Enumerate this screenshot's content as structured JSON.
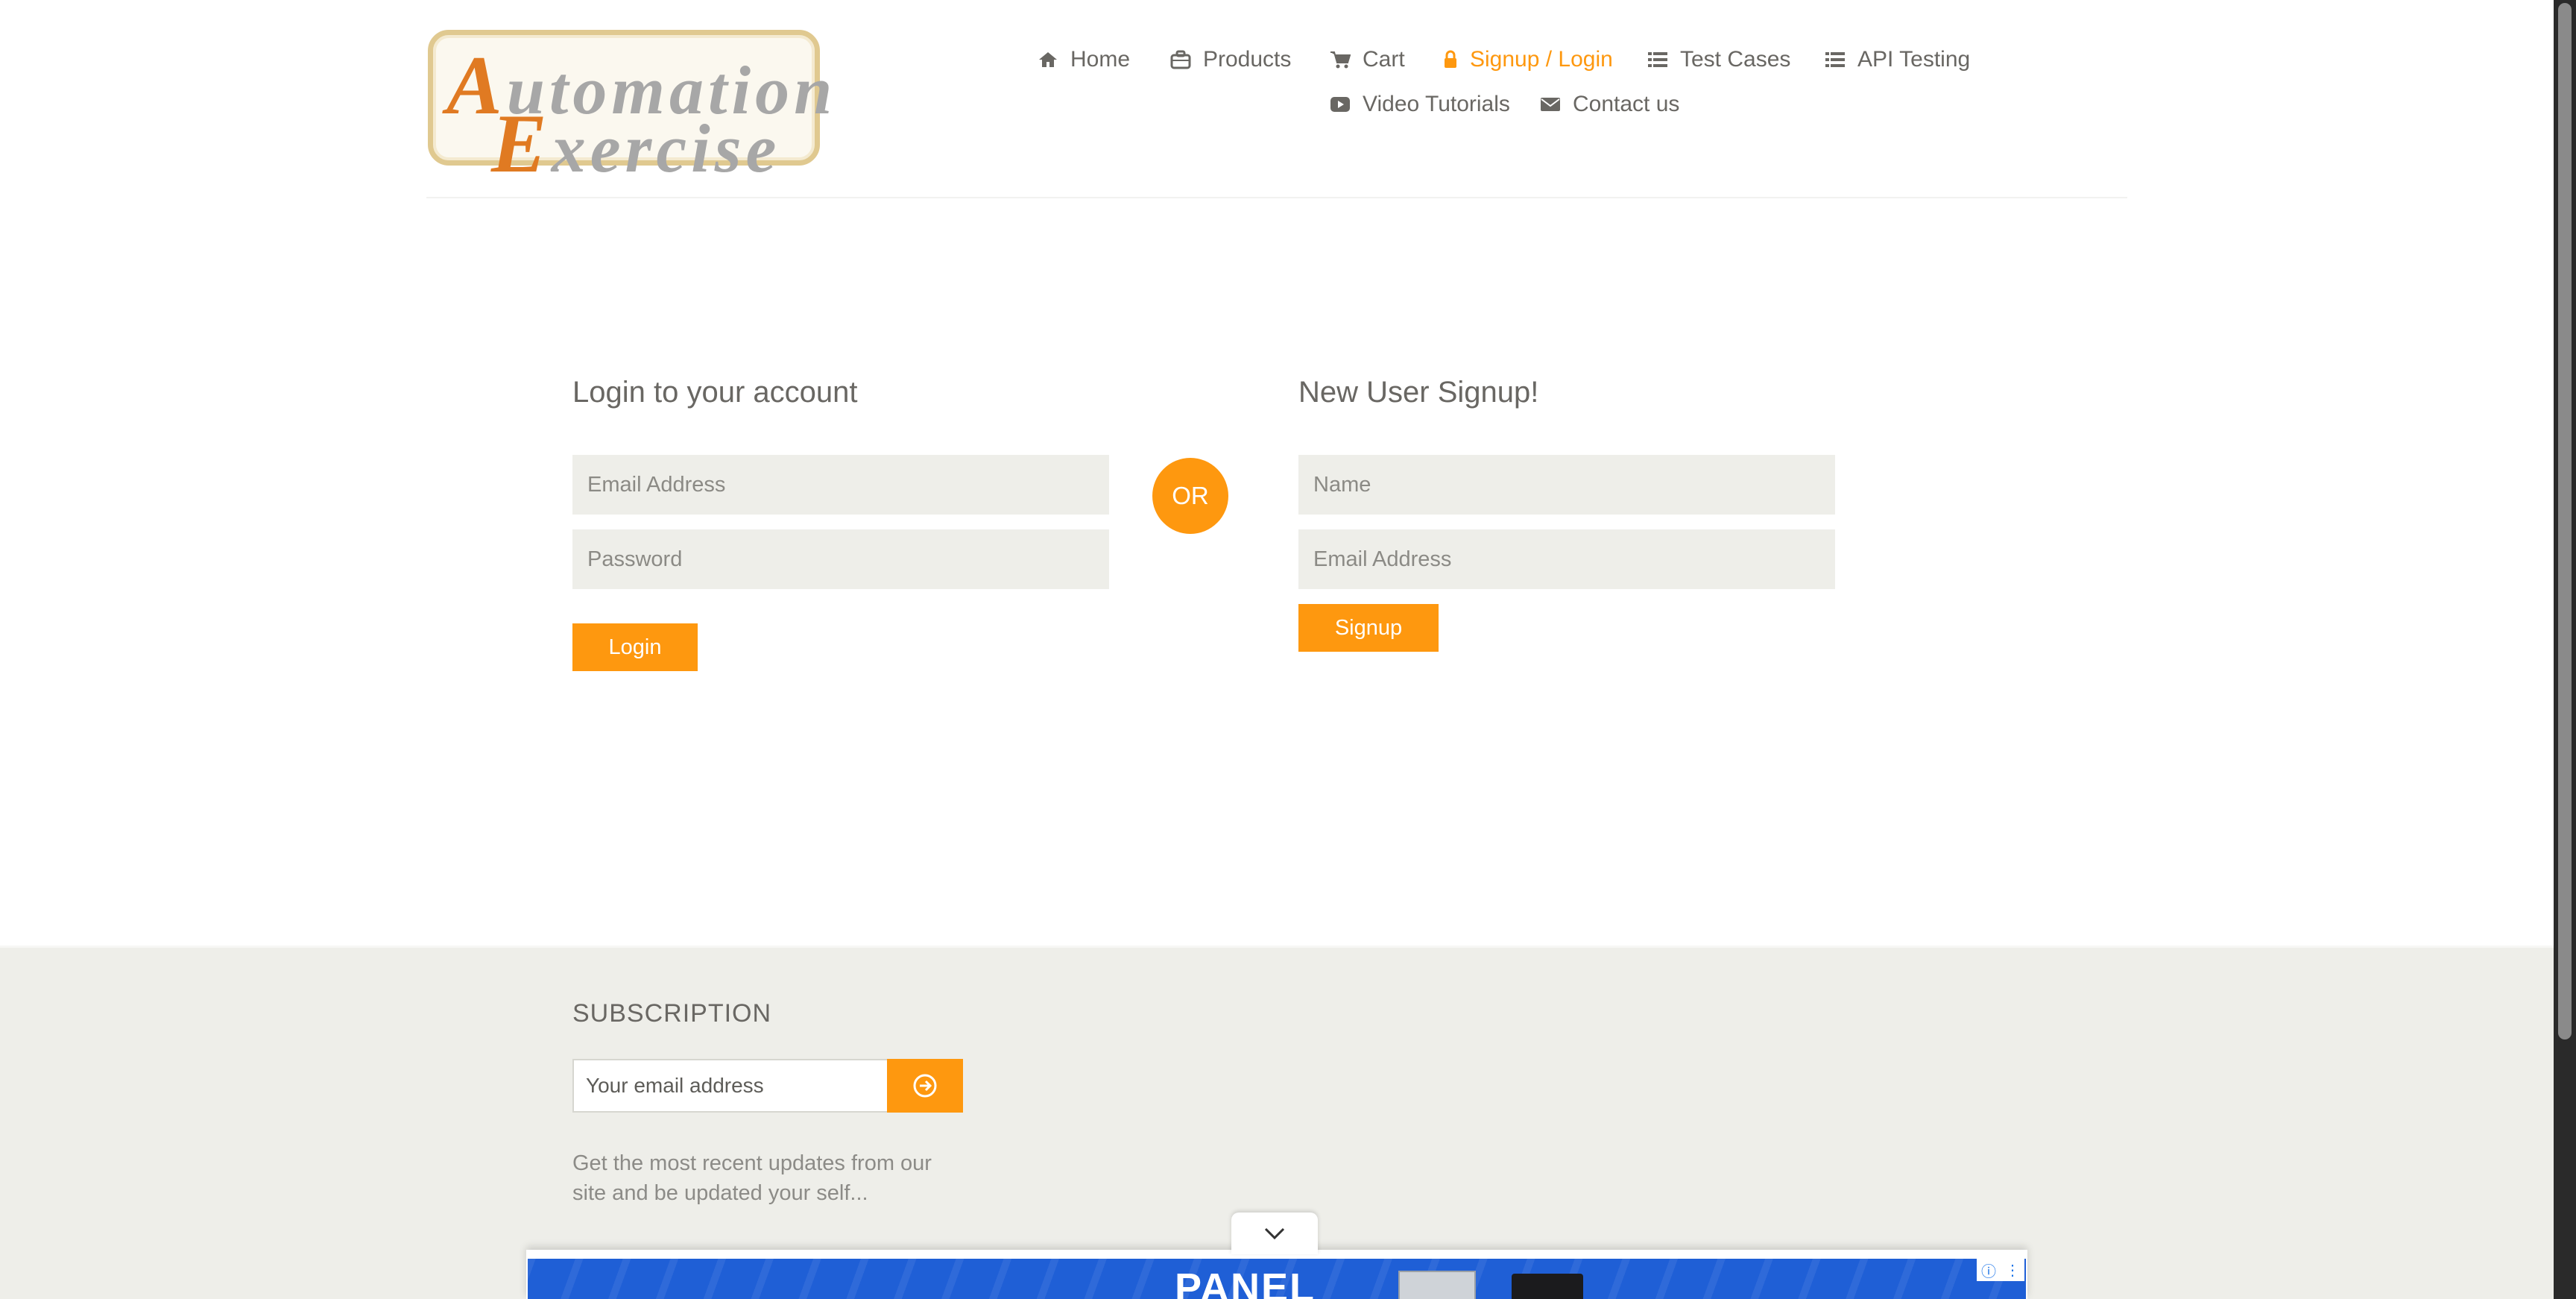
{
  "logo": {
    "line1_cap": "A",
    "line1_rest": "utomation",
    "line2_cap": "E",
    "line2_rest": "xercise"
  },
  "nav": {
    "items": [
      {
        "label": "Home",
        "icon": "home-icon"
      },
      {
        "label": "Products",
        "icon": "briefcase-icon"
      },
      {
        "label": "Cart",
        "icon": "cart-icon"
      },
      {
        "label": "Signup / Login",
        "icon": "lock-icon",
        "active": true
      },
      {
        "label": "Test Cases",
        "icon": "list-icon"
      },
      {
        "label": "API Testing",
        "icon": "list-icon"
      },
      {
        "label": "Video Tutorials",
        "icon": "youtube-play-icon"
      },
      {
        "label": "Contact us",
        "icon": "envelope-icon"
      }
    ]
  },
  "login": {
    "title": "Login to your account",
    "email_placeholder": "Email Address",
    "password_placeholder": "Password",
    "button": "Login"
  },
  "or_label": "OR",
  "signup": {
    "title": "New User Signup!",
    "name_placeholder": "Name",
    "email_placeholder": "Email Address",
    "button": "Signup"
  },
  "footer": {
    "subscription_title": "SUBSCRIPTION",
    "email_placeholder": "Your email address",
    "description": "Get the most recent updates from our site and be updated your self..."
  },
  "ad": {
    "text": "PANEL"
  },
  "colors": {
    "accent": "#fe980f",
    "text": "#696763",
    "field_bg": "#eeeee9"
  }
}
